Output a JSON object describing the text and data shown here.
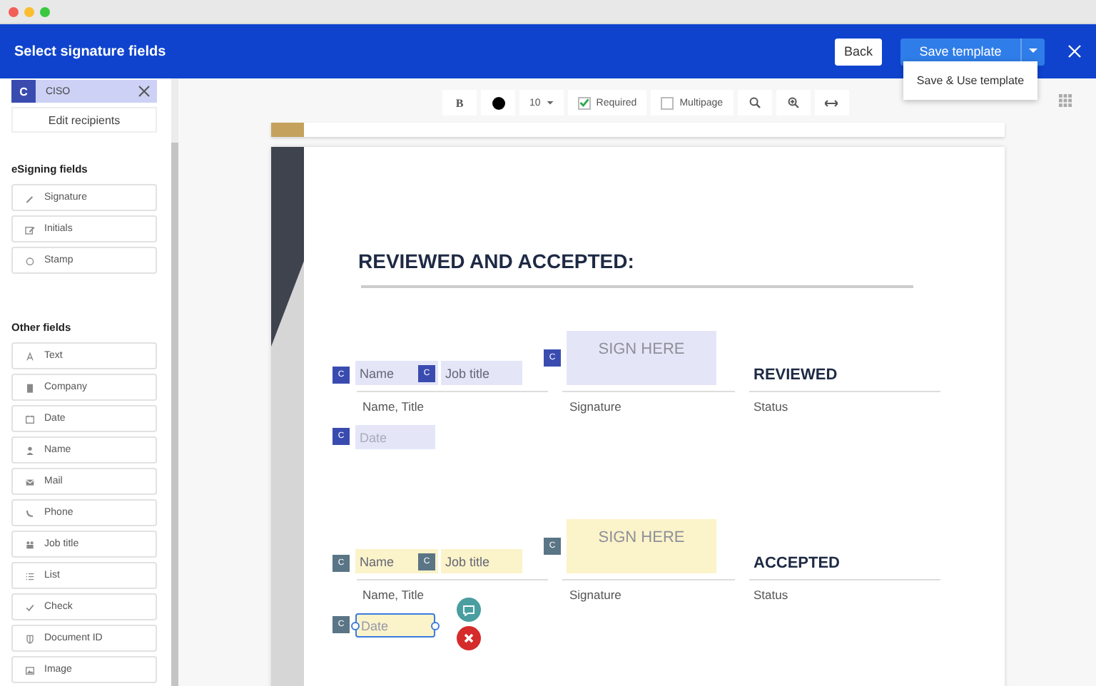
{
  "header": {
    "title": "Select signature fields",
    "back": "Back",
    "save": "Save template",
    "menu": [
      "Save & Use template"
    ]
  },
  "recipient": {
    "badge": "C",
    "name": "CISO",
    "edit": "Edit recipients"
  },
  "sections": [
    {
      "title": "eSigning fields",
      "items": [
        {
          "label": "Signature",
          "kind": "pen"
        },
        {
          "label": "Initials",
          "kind": "edit"
        },
        {
          "label": "Stamp",
          "kind": "circle"
        }
      ]
    },
    {
      "title": "Other fields",
      "items": [
        {
          "label": "Text",
          "kind": "text"
        },
        {
          "label": "Company",
          "kind": "building"
        },
        {
          "label": "Date",
          "kind": "calendar"
        },
        {
          "label": "Name",
          "kind": "person"
        },
        {
          "label": "Mail",
          "kind": "mail"
        },
        {
          "label": "Phone",
          "kind": "phone"
        },
        {
          "label": "Job title",
          "kind": "people"
        },
        {
          "label": "List",
          "kind": "list"
        },
        {
          "label": "Check",
          "kind": "check"
        },
        {
          "label": "Document ID",
          "kind": "shield"
        },
        {
          "label": "Image",
          "kind": "image"
        }
      ]
    }
  ],
  "toolbar": {
    "bold": "B",
    "font_size": "10",
    "required": {
      "label": "Required",
      "checked": true
    },
    "multipage": {
      "label": "Multipage",
      "checked": false
    }
  },
  "document": {
    "heading": "REVIEWED AND ACCEPTED:",
    "blocks": [
      {
        "badges": {
          "color": "#3a4bb0",
          "labels": [
            "C",
            "C",
            "C",
            "C"
          ]
        },
        "fields": {
          "color": "#e4e6f8"
        },
        "name": "Name",
        "job": "Job title",
        "sign": "SIGN HERE",
        "status": "REVIEWED",
        "labels": [
          "Name, Title",
          "Signature",
          "Status"
        ],
        "date": "Date",
        "date_selected": false
      },
      {
        "badges": {
          "color": "#5a7585",
          "labels": [
            "C",
            "C",
            "C",
            "C"
          ]
        },
        "fields": {
          "color": "#fbf3c9"
        },
        "name": "Name",
        "job": "Job title",
        "sign": "SIGN HERE",
        "status": "ACCEPTED",
        "labels": [
          "Name, Title",
          "Signature",
          "Status"
        ],
        "date": "Date",
        "date_selected": true
      }
    ]
  }
}
